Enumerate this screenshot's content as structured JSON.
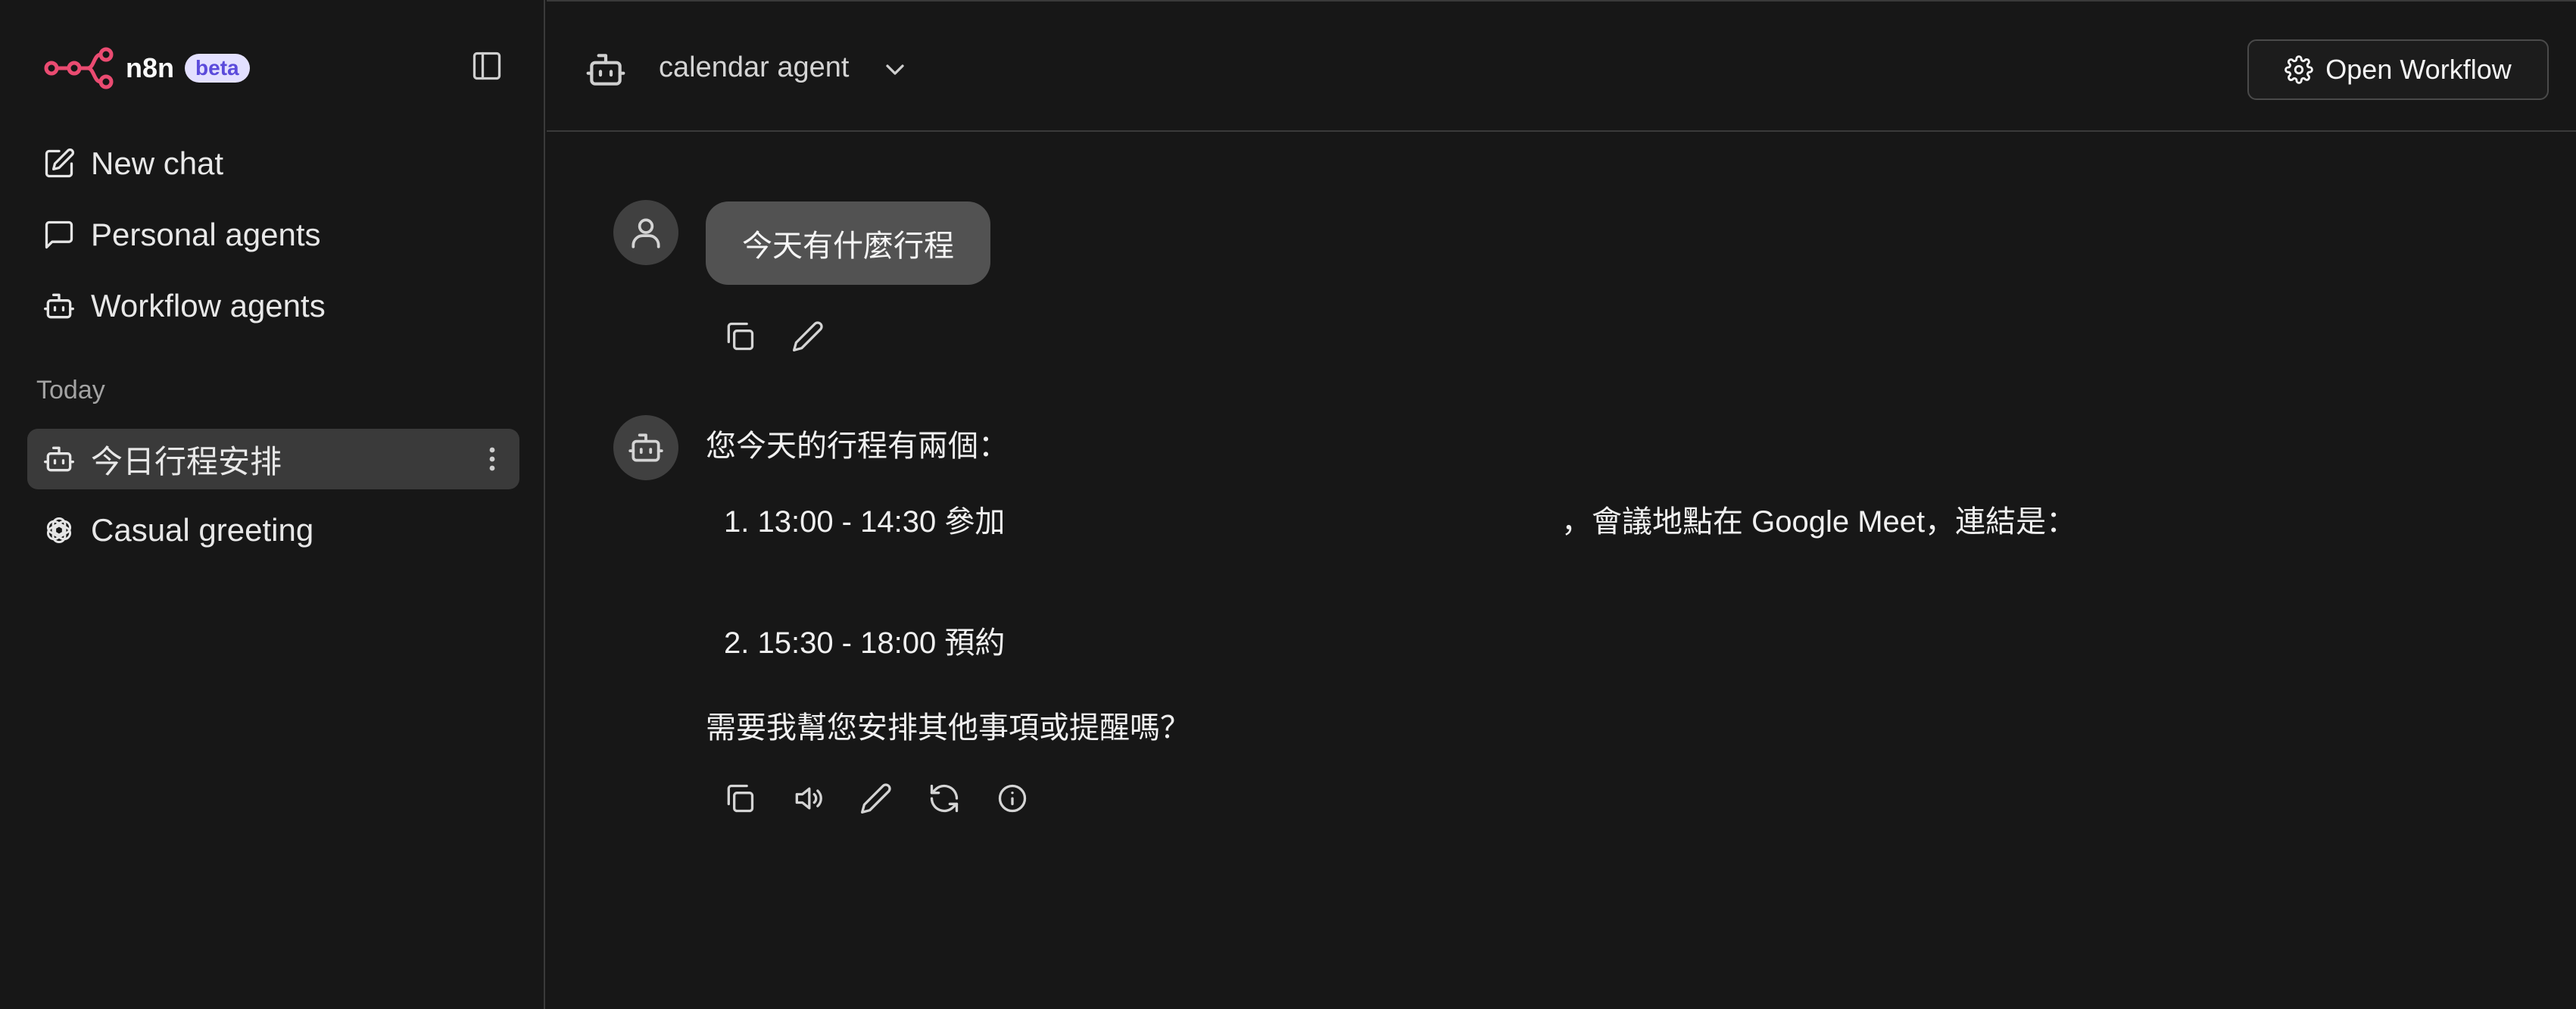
{
  "brand": {
    "name": "n8n",
    "badge": "beta",
    "logo_icon": "n8n-logo-icon",
    "accent": "#ea4b71"
  },
  "sidebar": {
    "toggle_icon": "sidebar-toggle-icon",
    "nav": [
      {
        "label": "New chat",
        "icon": "edit-icon"
      },
      {
        "label": "Personal agents",
        "icon": "message-icon"
      },
      {
        "label": "Workflow agents",
        "icon": "bot-icon"
      }
    ],
    "section_today": "Today",
    "history": [
      {
        "label": "今日行程安排",
        "icon": "bot-icon",
        "active": true
      },
      {
        "label": "Casual greeting",
        "icon": "openai-icon",
        "active": false
      }
    ]
  },
  "header": {
    "agent_name": "calendar agent",
    "agent_icon": "bot-icon",
    "open_workflow_label": "Open Workflow",
    "open_workflow_icon": "gear-icon"
  },
  "conversation": {
    "user_message": "今天有什麼行程",
    "assistant": {
      "intro": "您今天的行程有兩個：",
      "item1_prefix": "1. 13:00 - 14:30 參加",
      "item1_suffix": "，會議地點在 Google Meet，連結是：",
      "item2": "2. 15:30 - 18:00 預約",
      "closing": "需要我幫您安排其他事項或提醒嗎？"
    }
  }
}
